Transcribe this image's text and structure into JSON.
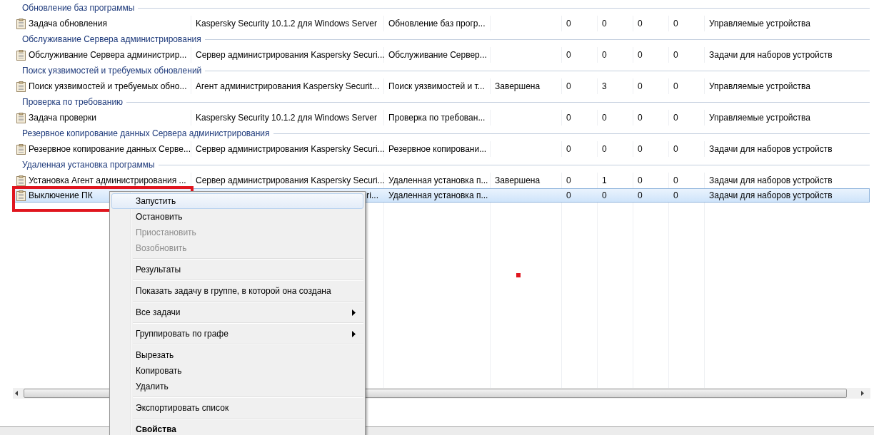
{
  "groups": [
    {
      "title": "Обновление баз программы",
      "rows": [
        {
          "selected": false,
          "cells": [
            "Задача обновления",
            "Kaspersky Security 10.1.2 для Windows Server",
            "Обновление баз прогр...",
            "",
            "0",
            "0",
            "0",
            "0",
            "Управляемые устройства"
          ]
        }
      ]
    },
    {
      "title": "Обслуживание Сервера администрирования",
      "rows": [
        {
          "selected": false,
          "cells": [
            "Обслуживание Сервера администрир...",
            "Сервер администрирования Kaspersky Securi...",
            "Обслуживание Сервер...",
            "",
            "0",
            "0",
            "0",
            "0",
            "Задачи для наборов устройств"
          ]
        }
      ]
    },
    {
      "title": "Поиск уязвимостей и требуемых обновлений",
      "rows": [
        {
          "selected": false,
          "cells": [
            "Поиск уязвимостей и требуемых обно...",
            "Агент администрирования Kaspersky Securit...",
            "Поиск уязвимостей и т...",
            "Завершена",
            "0",
            "3",
            "0",
            "0",
            "Управляемые устройства"
          ]
        }
      ]
    },
    {
      "title": "Проверка по требованию",
      "rows": [
        {
          "selected": false,
          "cells": [
            "Задача проверки",
            "Kaspersky Security 10.1.2 для Windows Server",
            "Проверка по требован...",
            "",
            "0",
            "0",
            "0",
            "0",
            "Управляемые устройства"
          ]
        }
      ]
    },
    {
      "title": "Резервное копирование данных Сервера администрирования",
      "rows": [
        {
          "selected": false,
          "cells": [
            "Резервное копирование данных Серве...",
            "Сервер администрирования Kaspersky Securi...",
            "Резервное копировани...",
            "",
            "0",
            "0",
            "0",
            "0",
            "Задачи для наборов устройств"
          ]
        }
      ]
    },
    {
      "title": "Удаленная установка программы",
      "rows": [
        {
          "selected": false,
          "cells": [
            "Установка Агент администрирования ...",
            "Сервер администрирования Kaspersky Securi...",
            "Удаленная установка п...",
            "Завершена",
            "0",
            "1",
            "0",
            "0",
            "Задачи для наборов устройств"
          ]
        },
        {
          "selected": true,
          "cells": [
            "Выключение ПК",
            "ri...",
            "Удаленная установка п...",
            "",
            "0",
            "0",
            "0",
            "0",
            "Задачи для наборов устройств"
          ]
        }
      ]
    }
  ],
  "context_menu": [
    {
      "kind": "item",
      "label": "Запустить",
      "highlighted": true,
      "disabled": false
    },
    {
      "kind": "item",
      "label": "Остановить",
      "highlighted": false,
      "disabled": false
    },
    {
      "kind": "item",
      "label": "Приостановить",
      "highlighted": false,
      "disabled": true
    },
    {
      "kind": "item",
      "label": "Возобновить",
      "highlighted": false,
      "disabled": true
    },
    {
      "kind": "separator"
    },
    {
      "kind": "item",
      "label": "Результаты",
      "highlighted": false,
      "disabled": false
    },
    {
      "kind": "separator"
    },
    {
      "kind": "item",
      "label": "Показать задачу в группе, в которой она создана",
      "highlighted": false,
      "disabled": false
    },
    {
      "kind": "separator"
    },
    {
      "kind": "submenu",
      "label": "Все задачи",
      "highlighted": false,
      "disabled": false
    },
    {
      "kind": "separator"
    },
    {
      "kind": "submenu",
      "label": "Группировать по графе",
      "highlighted": false,
      "disabled": false
    },
    {
      "kind": "separator"
    },
    {
      "kind": "item",
      "label": "Вырезать",
      "highlighted": false,
      "disabled": false
    },
    {
      "kind": "item",
      "label": "Копировать",
      "highlighted": false,
      "disabled": false
    },
    {
      "kind": "item",
      "label": "Удалить",
      "highlighted": false,
      "disabled": false
    },
    {
      "kind": "separator"
    },
    {
      "kind": "item",
      "label": "Экспортировать список",
      "highlighted": false,
      "disabled": false
    },
    {
      "kind": "separator"
    },
    {
      "kind": "default",
      "label": "Свойства",
      "highlighted": false,
      "disabled": false
    }
  ]
}
